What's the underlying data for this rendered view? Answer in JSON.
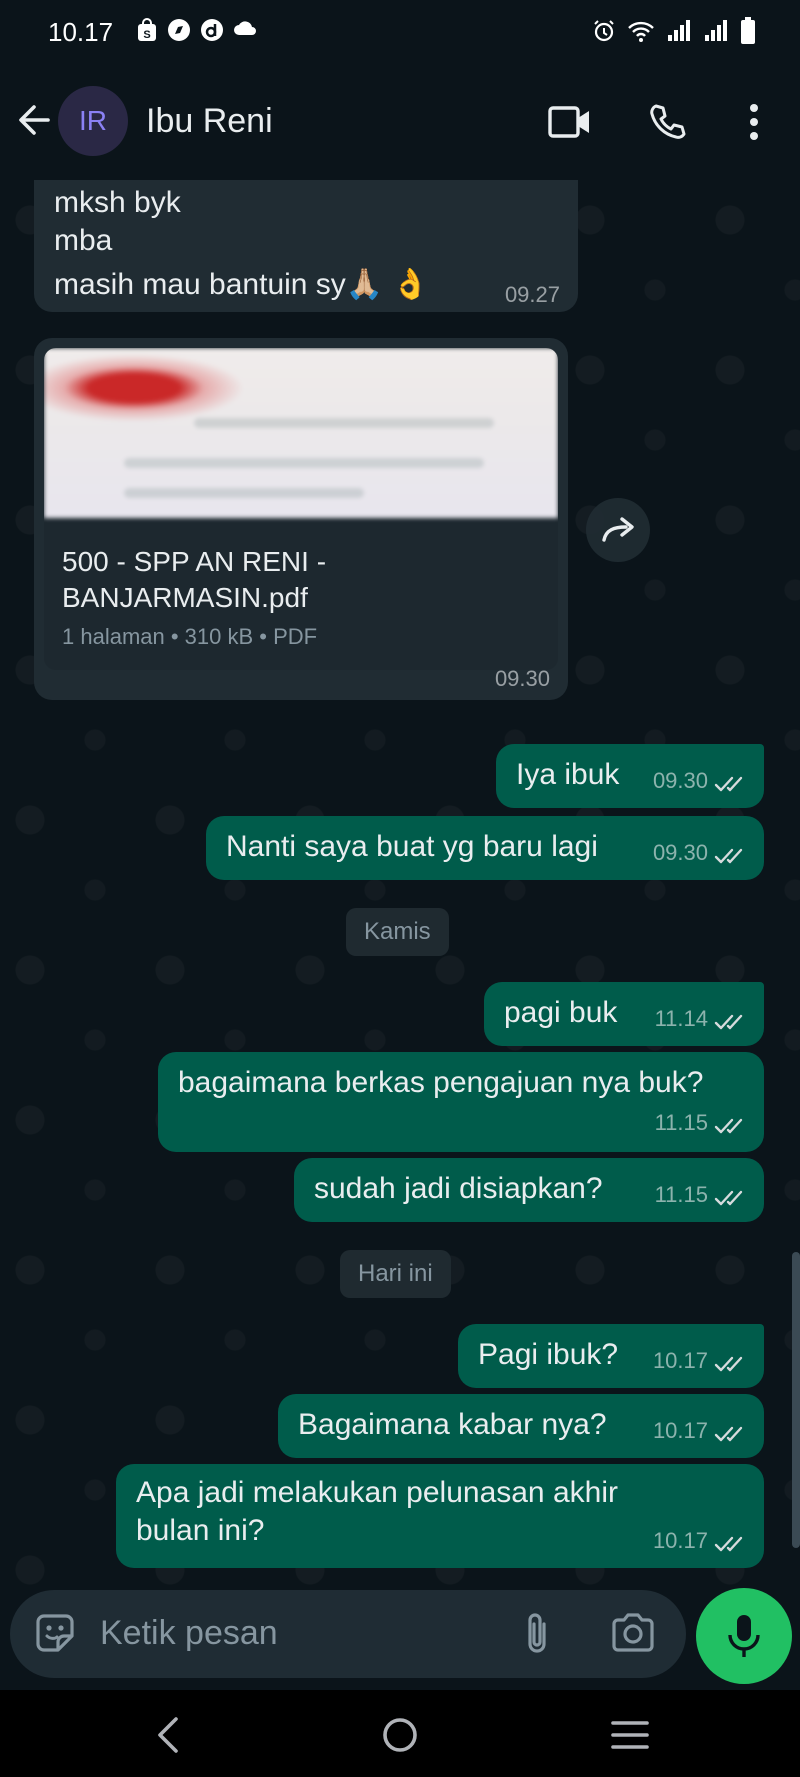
{
  "status_bar": {
    "time": "10.17",
    "left_icons": [
      "shopping-bag-icon",
      "compass-app-icon",
      "d-app-icon",
      "cloud-icon"
    ],
    "right_icons": [
      "alarm-icon",
      "wifi-icon",
      "signal-icon",
      "signal-icon",
      "battery-icon"
    ]
  },
  "header": {
    "avatar_initials": "IR",
    "contact_name": "Ibu Reni",
    "icons": [
      "back-arrow-icon",
      "video-call-icon",
      "voice-call-icon",
      "more-options-icon"
    ]
  },
  "messages": [
    {
      "direction": "in",
      "lines": [
        "mksh byk",
        "mba",
        "masih mau bantuin sy🙏🏼 👌"
      ],
      "time": "09.27"
    },
    {
      "direction": "in",
      "type": "document",
      "file_name": "500 - SPP AN RENI - BANJARMASIN.pdf",
      "file_meta": "1 halaman • 310 kB • PDF",
      "time": "09.30"
    },
    {
      "direction": "out",
      "text": "Iya ibuk",
      "time": "09.30",
      "status": "read"
    },
    {
      "direction": "out",
      "text": "Nanti saya buat yg baru lagi",
      "time": "09.30",
      "status": "read"
    },
    {
      "type": "date",
      "label": "Kamis"
    },
    {
      "direction": "out",
      "text": "pagi buk",
      "time": "11.14",
      "status": "read"
    },
    {
      "direction": "out",
      "text": "bagaimana berkas pengajuan nya buk?",
      "time": "11.15",
      "status": "read"
    },
    {
      "direction": "out",
      "text": "sudah jadi disiapkan?",
      "time": "11.15",
      "status": "read"
    },
    {
      "type": "date",
      "label": "Hari ini"
    },
    {
      "direction": "out",
      "text": "Pagi ibuk?",
      "time": "10.17",
      "status": "read"
    },
    {
      "direction": "out",
      "text": "Bagaimana kabar nya?",
      "time": "10.17",
      "status": "read"
    },
    {
      "direction": "out",
      "text": "Apa jadi melakukan pelunasan akhir bulan ini?",
      "time": "10.17",
      "status": "read"
    }
  ],
  "composer": {
    "placeholder": "Ketik pesan",
    "icons": [
      "sticker-icon",
      "attach-icon",
      "camera-icon",
      "mic-icon"
    ]
  },
  "nav_bar": {
    "icons": [
      "nav-back-icon",
      "nav-home-icon",
      "nav-recents-icon"
    ]
  },
  "colors": {
    "background": "#0b141a",
    "incoming_bubble": "#202c33",
    "outgoing_bubble": "#005c4b",
    "accent_green": "#21c063",
    "avatar_text": "#8b81f5"
  }
}
